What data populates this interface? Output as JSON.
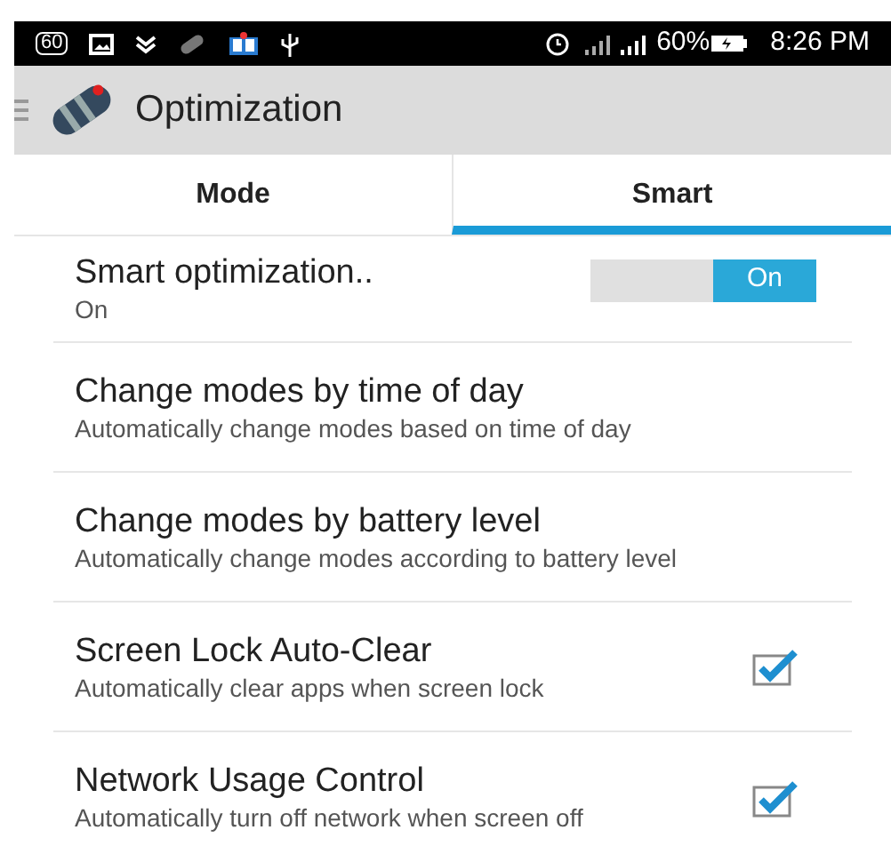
{
  "status_bar": {
    "badge": "60",
    "battery": "60%",
    "time": "8:26 PM"
  },
  "app_bar": {
    "title": "Optimization"
  },
  "tabs": [
    {
      "label": "Mode",
      "selected": false
    },
    {
      "label": "Smart",
      "selected": true
    }
  ],
  "settings": [
    {
      "kind": "toggle",
      "title": "Smart optimization..",
      "summary": "On",
      "on": true,
      "toggle_label": "On"
    },
    {
      "kind": "plain",
      "title": "Change modes by time of day",
      "summary": "Automatically change modes based on time of day"
    },
    {
      "kind": "plain",
      "title": "Change modes by battery level",
      "summary": "Automatically change modes according to battery level"
    },
    {
      "kind": "checkbox",
      "title": "Screen Lock Auto-Clear",
      "summary": "Automatically clear apps when screen lock",
      "checked": true
    },
    {
      "kind": "checkbox",
      "title": "Network Usage Control",
      "summary": "Automatically turn off network when screen off",
      "checked": true
    }
  ]
}
